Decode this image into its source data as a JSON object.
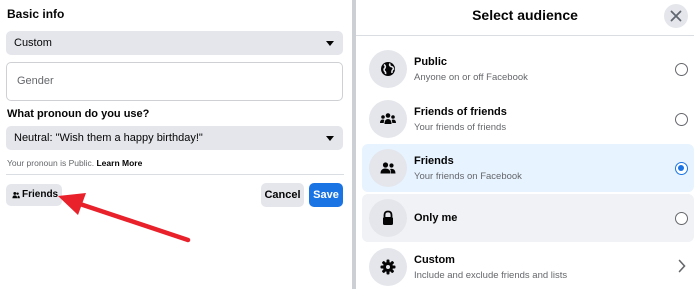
{
  "left": {
    "section_title": "Basic info",
    "gender_select_value": "Custom",
    "gender_input_placeholder": "Gender",
    "pronoun_question": "What pronoun do you use?",
    "pronoun_select_value": "Neutral: \"Wish them a happy birthday!\"",
    "hint_text": "Your pronoun is Public.",
    "hint_link": "Learn More",
    "audience_button_label": "Friends",
    "cancel_label": "Cancel",
    "save_label": "Save"
  },
  "modal": {
    "title": "Select audience",
    "options": [
      {
        "label": "Public",
        "sub": "Anyone on or off Facebook",
        "icon": "globe-icon",
        "state": "unselected"
      },
      {
        "label": "Friends of friends",
        "sub": "Your friends of friends",
        "icon": "friends-of-friends-icon",
        "state": "unselected"
      },
      {
        "label": "Friends",
        "sub": "Your friends on Facebook",
        "icon": "friends-icon",
        "state": "selected"
      },
      {
        "label": "Only me",
        "sub": "",
        "icon": "lock-icon",
        "state": "hover"
      },
      {
        "label": "Custom",
        "sub": "Include and exclude friends and lists",
        "icon": "gear-icon",
        "state": "chevron"
      }
    ]
  },
  "colors": {
    "accent": "#1b74e4",
    "selected_row": "#e7f3ff",
    "annotation_arrow": "#e8212b"
  }
}
